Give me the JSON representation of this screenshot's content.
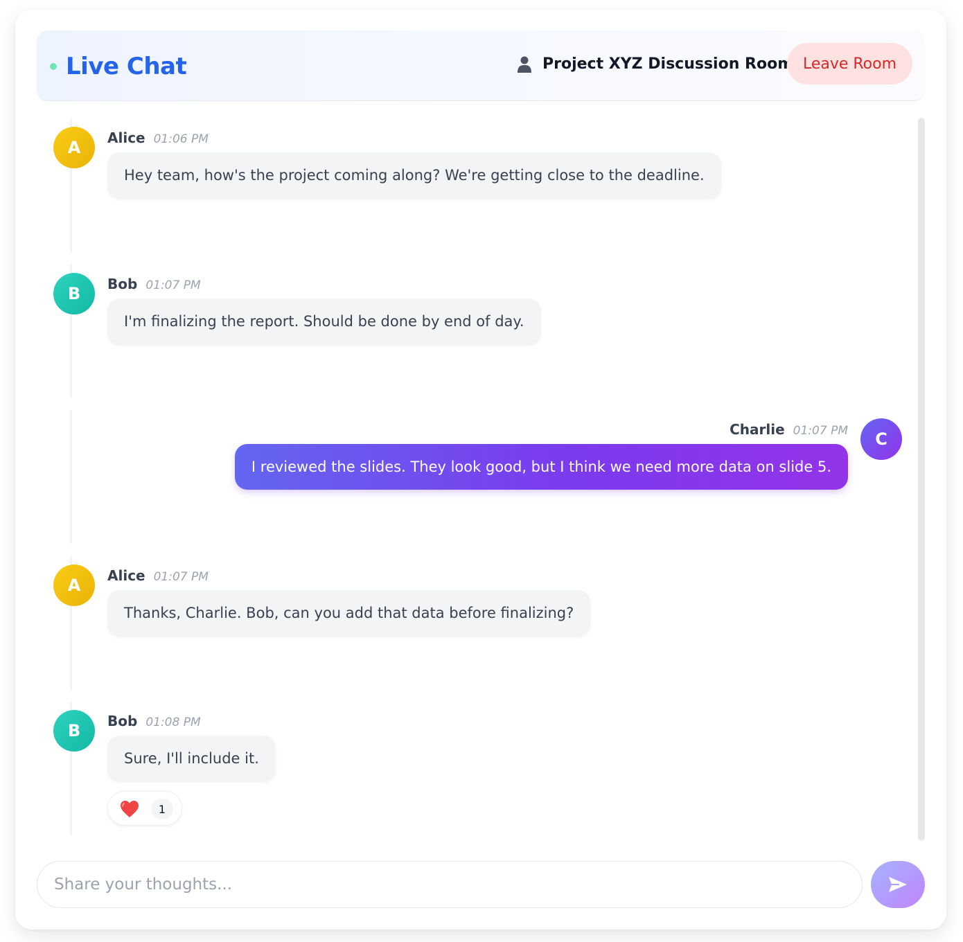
{
  "header": {
    "title": "Live Chat",
    "room_name": "Project XYZ Discussion Room",
    "leave_label": "Leave Room"
  },
  "messages": [
    {
      "initial": "A",
      "author": "Alice",
      "time": "01:06 PM",
      "text": "Hey team, how's the project coming along? We're getting close to the deadline.",
      "color": "#eab308"
    },
    {
      "initial": "B",
      "author": "Bob",
      "time": "01:07 PM",
      "text": "I'm finalizing the report. Should be done by end of day.",
      "color": "#14b8a6"
    },
    {
      "initial": "C",
      "author": "Charlie",
      "time": "01:07 PM",
      "text": "I reviewed the slides. They look good, but I think we need more data on slide 5.",
      "color": "#7c3aed"
    },
    {
      "initial": "A",
      "author": "Alice",
      "time": "01:07 PM",
      "text": "Thanks, Charlie. Bob, can you add that data before finalizing?",
      "color": "#eab308"
    },
    {
      "initial": "B",
      "author": "Bob",
      "time": "01:08 PM",
      "text": "Sure, I'll include it.",
      "color": "#14b8a6",
      "reaction": {
        "icon": "heart-icon",
        "count": "1"
      }
    }
  ],
  "composer": {
    "placeholder": "Share your thoughts...",
    "send_icon": "send-icon"
  },
  "colors": {
    "accent": "#2563eb",
    "online": "#6ee7b7",
    "leave_text": "#dc2626",
    "leave_bg": "#fee2e2"
  }
}
